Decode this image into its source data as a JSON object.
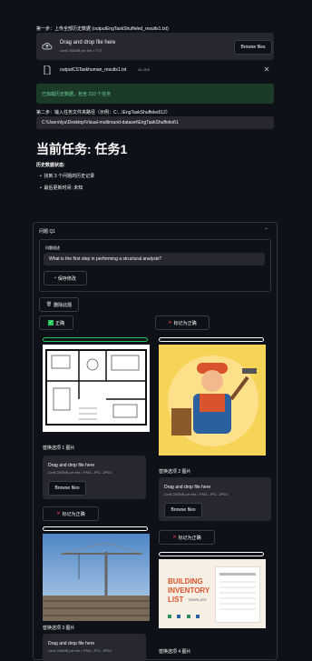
{
  "step1": {
    "label": "第一步：上传全部历史数据 (outputEngTaskShuffeled_results1.txt)"
  },
  "uploader1": {
    "drag_text": "Drag and drop file here",
    "limit": "Limit 200MB per file • TXT",
    "browse": "Browse files"
  },
  "file": {
    "name": "outputCSTaskhuman_results1.txt",
    "size": "46.3KB"
  },
  "success": "已加载历史数据，包含 210 个任务",
  "step2": {
    "label": "第二步：输入任务文件夹路径（示例：C:...\\EngTaskShuffeled\\12）",
    "value": "C:\\Users\\lyu\\Desktop\\Visual-multiround-dataset\\EngTaskShuffeled\\1"
  },
  "title": "当前任务: 任务1",
  "history": {
    "label": "历史数据状态:",
    "items": [
      "找到 3 个问题的历史记录",
      "最后更新时间: 未知"
    ]
  },
  "question": {
    "header": "问题 Q1",
    "desc_label": "问题描述",
    "text": "What is the first step in performing a structural analysis?",
    "save": "保存修改",
    "delete": "删除此题"
  },
  "options": {
    "correct": "正确",
    "mark_correct": "标记为正确",
    "replace1": "替换选项 1 图片",
    "replace2": "替换选项 2 图片",
    "replace3": "替换选项 3 图片",
    "replace4": "替换选项 4 图片",
    "drag": "Drag and drop file here",
    "limit": "Limit 200MB per file • PNG, JPG, JPEG",
    "browse": "Browse files"
  },
  "image_text": {
    "inv1": "BUILDING",
    "inv2": "INVENTORY",
    "inv3": "LIST",
    "inv4": "TEMPLATE"
  },
  "colors": {
    "bg": "#0e1117",
    "panel": "#262730",
    "success_bg": "#1b3a28",
    "accent_red": "#ff4b4b",
    "accent_green": "#22c55e"
  }
}
